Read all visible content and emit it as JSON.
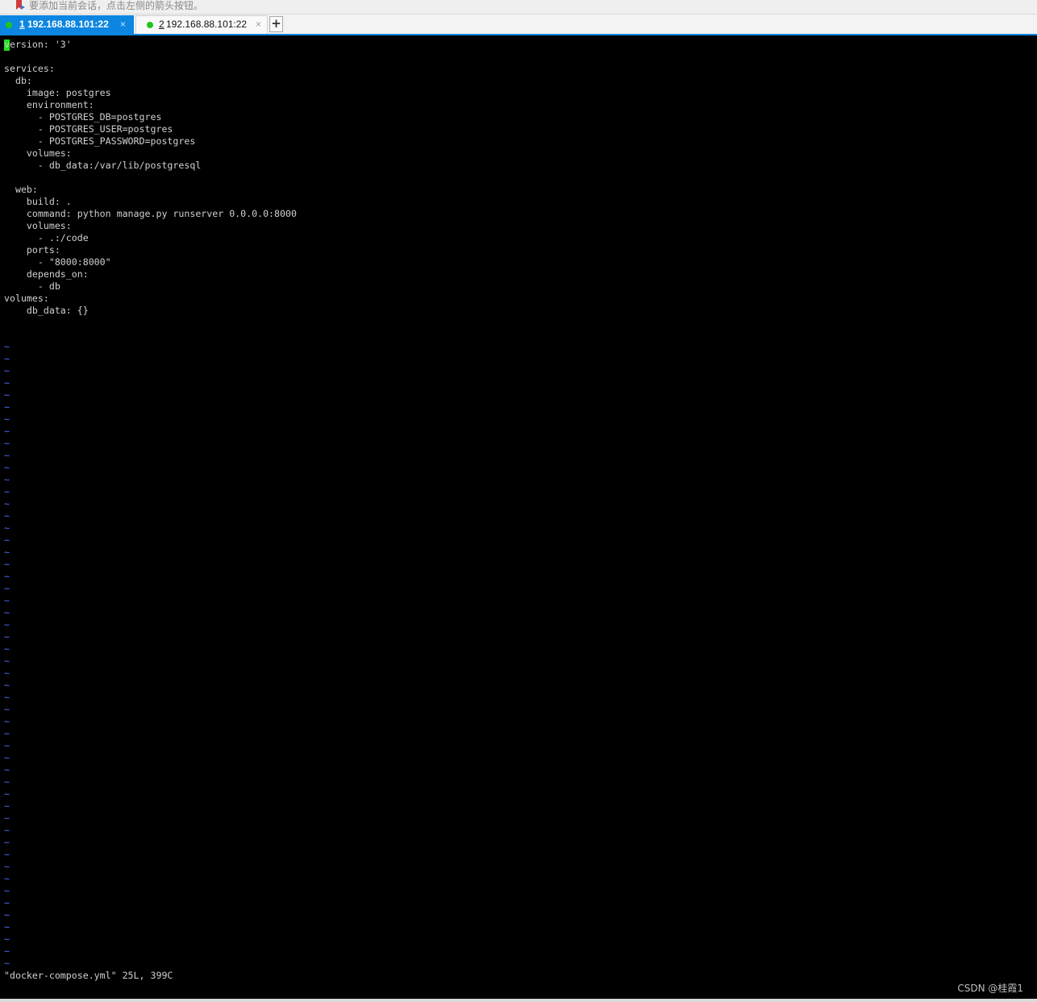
{
  "hint_bar": {
    "icon": "bookmark-arrow-icon",
    "text": "要添加当前会话，点击左侧的箭头按钮。"
  },
  "tabs": [
    {
      "number": "1",
      "host": "192.168.88.101:22",
      "active": true,
      "status_color": "#1ec61e",
      "close_glyph": "×"
    },
    {
      "number": "2",
      "host": "192.168.88.101:22",
      "active": false,
      "status_color": "#1ec61e",
      "close_glyph": "×"
    }
  ],
  "new_tab_label": "+",
  "editor": {
    "cursor_char": "v",
    "lines": [
      "version: '3'",
      "",
      "services:",
      "  db:",
      "    image: postgres",
      "    environment:",
      "      - POSTGRES_DB=postgres",
      "      - POSTGRES_USER=postgres",
      "      - POSTGRES_PASSWORD=postgres",
      "    volumes:",
      "      - db_data:/var/lib/postgresql",
      "",
      "  web:",
      "    build: .",
      "    command: python manage.py runserver 0.0.0.0:8000",
      "    volumes:",
      "      - .:/code",
      "    ports:",
      "      - \"8000:8000\"",
      "    depends_on:",
      "      - db",
      "volumes:",
      "    db_data: {}",
      "",
      ""
    ],
    "empty_line_marker": "~",
    "empty_line_count": 52,
    "status_line": "\"docker-compose.yml\" 25L, 399C"
  },
  "watermark": "CSDN @桂霞1",
  "colors": {
    "accent": "#0c86e0",
    "terminal_bg": "#000000",
    "terminal_fg": "#d0d0d0",
    "tilde": "#4a6bff",
    "cursor": "#1ee01e"
  }
}
